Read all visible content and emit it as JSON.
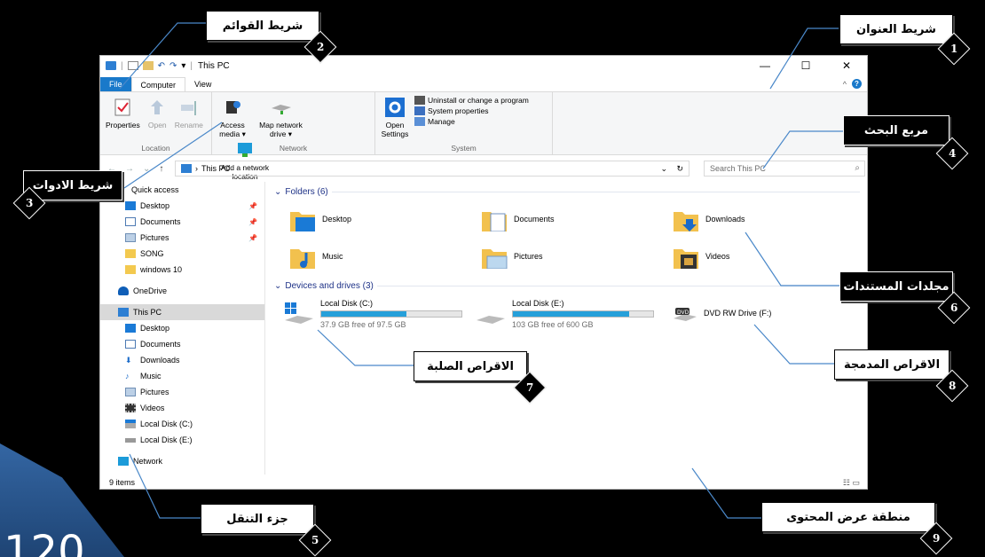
{
  "corner_text": "120",
  "window": {
    "title": "This PC",
    "controls": {
      "minimize": "—",
      "maximize": "☐",
      "close": "✕"
    }
  },
  "tabs": {
    "file": "File",
    "computer": "Computer",
    "view": "View"
  },
  "ribbon": {
    "location": {
      "label": "Location",
      "properties": "Properties",
      "open": "Open",
      "rename": "Rename"
    },
    "network": {
      "label": "Network",
      "access_media": "Access media ▾",
      "map_drive": "Map network drive ▾",
      "add_location": "Add a network location"
    },
    "system": {
      "label": "System",
      "open_settings": "Open Settings",
      "uninstall": "Uninstall or change a program",
      "system_properties": "System properties",
      "manage": "Manage"
    }
  },
  "address": {
    "path": "This PC",
    "search_placeholder": "Search This PC"
  },
  "nav": {
    "quick_access": "Quick access",
    "items": [
      "Desktop",
      "Documents",
      "Pictures",
      "SONG",
      "windows 10"
    ],
    "onedrive": "OneDrive",
    "thispc": "This PC",
    "pc_items": [
      "Desktop",
      "Documents",
      "Downloads",
      "Music",
      "Pictures",
      "Videos",
      "Local Disk (C:)",
      "Local Disk (E:)"
    ],
    "network": "Network"
  },
  "content": {
    "folders_header": "Folders (6)",
    "folders": [
      "Desktop",
      "Documents",
      "Downloads",
      "Music",
      "Pictures",
      "Videos"
    ],
    "devices_header": "Devices and drives (3)",
    "drives": [
      {
        "name": "Local Disk (C:)",
        "free": "37.9 GB free of 97.5 GB",
        "used_fraction": 0.61
      },
      {
        "name": "Local Disk (E:)",
        "free": "103 GB free of 600 GB",
        "used_fraction": 0.83
      },
      {
        "name": "DVD RW Drive (F:)"
      }
    ]
  },
  "status": {
    "items": "9 items"
  },
  "callouts": {
    "c1": {
      "num": "1",
      "text": "شريط العنوان"
    },
    "c2": {
      "num": "2",
      "text": "شريط القوائم"
    },
    "c3": {
      "num": "3",
      "text": "شريط الادوات"
    },
    "c4": {
      "num": "4",
      "text": "مربع البحث"
    },
    "c5": {
      "num": "5",
      "text": "جزء التنقل"
    },
    "c6": {
      "num": "6",
      "text": "مجلدات المستندات"
    },
    "c7": {
      "num": "7",
      "text": "الاقراص الصلبة"
    },
    "c8": {
      "num": "8",
      "text": "الاقراص المدمجة"
    },
    "c9": {
      "num": "9",
      "text": "منطقة عرض المحتوى"
    }
  }
}
